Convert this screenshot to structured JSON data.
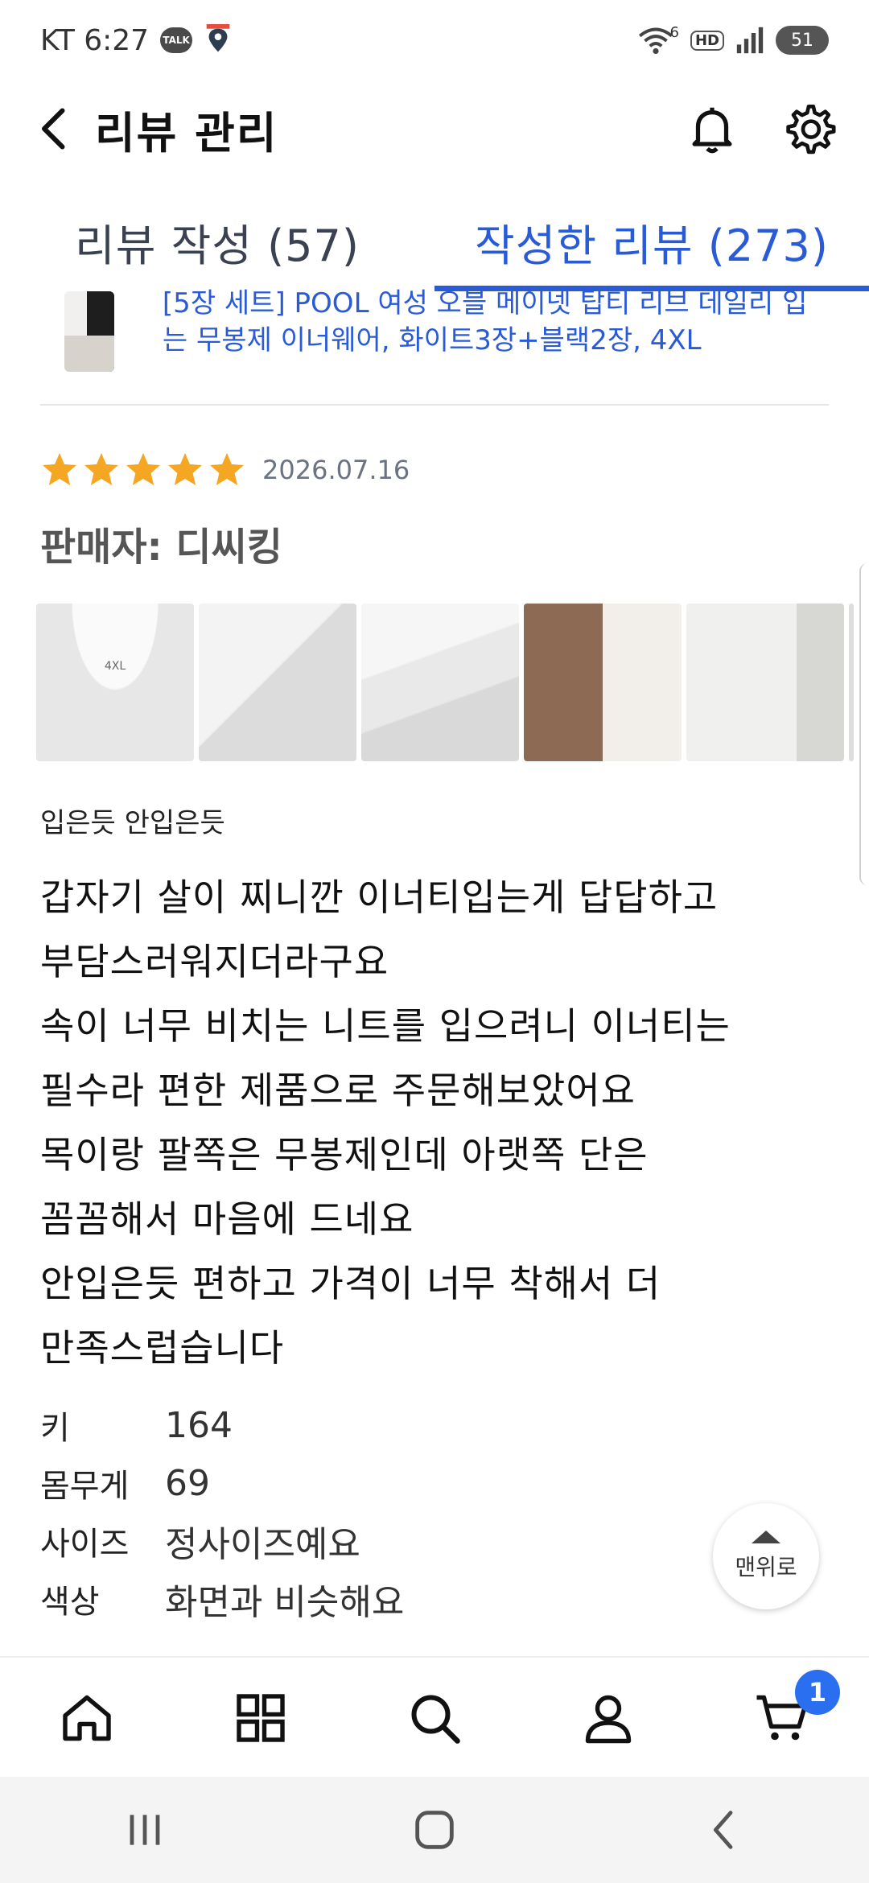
{
  "status_bar": {
    "carrier_time": "KT 6:27",
    "talk_label": "TALK",
    "hd_label": "HD",
    "battery": "51",
    "network": "6"
  },
  "header": {
    "title": "리뷰 관리"
  },
  "tabs": [
    {
      "label": "리뷰 작성 (57)",
      "active": false
    },
    {
      "label": "작성한 리뷰 (273)",
      "active": true
    }
  ],
  "product": {
    "name": "[5장 세트] POOL 여성 오블 메이넷 탑티 리브 데일리 입는 무봉제 이너웨어, 화이트3장+블랙2장, 4XL"
  },
  "review": {
    "rating": 5,
    "date": "2026.07.16",
    "seller": "판매자: 디씨킹",
    "title": "입은듯 안입은듯",
    "body_lines": [
      "갑자기 살이 찌니깐 이너티입는게 답답하고",
      "부담스러워지더라구요",
      "속이 너무 비치는 니트를 입으려니 이너티는",
      "필수라 편한 제품으로 주문해보았어요",
      "목이랑 팔쪽은 무봉제인데 아랫쪽 단은",
      "꼼꼼해서 마음에 드네요",
      "안입은듯 편하고 가격이 너무 착해서 더",
      "만족스럽습니다"
    ],
    "attributes": [
      {
        "label": "키",
        "value": "164"
      },
      {
        "label": "몸무게",
        "value": "69"
      },
      {
        "label": "사이즈",
        "value": "정사이즈예요"
      },
      {
        "label": "색상",
        "value": "화면과 비슷해요"
      }
    ]
  },
  "to_top": {
    "label": "맨위로"
  },
  "bottom_nav": {
    "cart_badge": "1"
  },
  "colors": {
    "accent": "#2a5bd7",
    "star": "#f5a623",
    "badge": "#2a6ff0"
  }
}
